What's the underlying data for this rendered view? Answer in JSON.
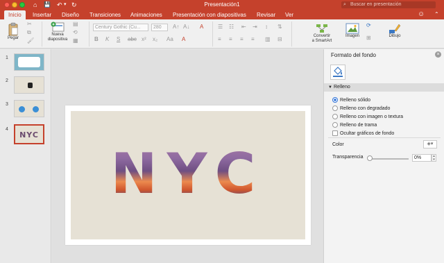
{
  "window": {
    "title": "Presentación1",
    "search_placeholder": "Buscar en presentación"
  },
  "quick_access": {
    "save": "💾",
    "undo": "↶",
    "undo_menu": "▾",
    "redo": "↻",
    "home": "⌂"
  },
  "tabs": [
    {
      "label": "Inicio",
      "active": true
    },
    {
      "label": "Insertar"
    },
    {
      "label": "Diseño"
    },
    {
      "label": "Transiciones"
    },
    {
      "label": "Animaciones"
    },
    {
      "label": "Presentación con diapositivas"
    },
    {
      "label": "Revisar"
    },
    {
      "label": "Ver"
    }
  ],
  "ribbon": {
    "paste_label": "Pegar",
    "new_slide_label": "Nueva",
    "new_slide_label2": "diapositiva",
    "font_name": "Century Gothic (Cu...",
    "font_size": "280",
    "convert_label": "Convertir",
    "convert_label2": "a SmartArt",
    "image_label": "Imagen",
    "drawing_label": "Dibujo",
    "bold": "B",
    "italic": "K",
    "underline": "S",
    "strike": "abc",
    "superscript": "x²",
    "subscript": "x₂",
    "grow": "A↑",
    "shrink": "A↓",
    "case": "Aa",
    "font_color": "A",
    "clear_format": "A"
  },
  "slides": [
    {
      "number": "1"
    },
    {
      "number": "2"
    },
    {
      "number": "3"
    },
    {
      "number": "4",
      "text": "NYC",
      "selected": true
    }
  ],
  "slide": {
    "text": "NYC"
  },
  "format_pane": {
    "title": "Formato del fondo",
    "close": "×",
    "section": "Relleno",
    "options": [
      {
        "label": "Relleno sólido",
        "selected": true
      },
      {
        "label": "Relleno con degradado"
      },
      {
        "label": "Relleno con imagen o textura"
      },
      {
        "label": "Relleno de trama"
      }
    ],
    "hide_graphics_label": "Ocultar gráficos de fondo",
    "color_label": "Color",
    "transparency_label": "Transparencia",
    "transparency_value": "0%"
  },
  "colors": {
    "accent": "#c5412c",
    "selection": "#2f73d9"
  }
}
